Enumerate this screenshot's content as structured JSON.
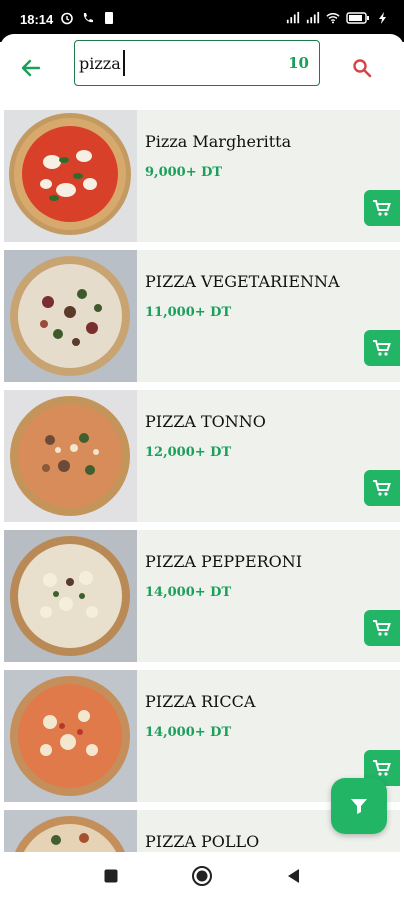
{
  "status_bar": {
    "time": "18:14",
    "icons": [
      "alarm-icon",
      "phone-icon",
      "sim-icon",
      "signal-icon",
      "signal-icon",
      "wifi-icon",
      "battery-icon",
      "charging-icon"
    ]
  },
  "header": {
    "back_icon": "arrow-left-icon",
    "search_value": "pizza",
    "result_count": "10",
    "search_icon": "search-icon"
  },
  "colors": {
    "accent": "#22b566",
    "price_green": "#1aa05a",
    "card_bg": "#eef1ec",
    "search_icon": "#d64545"
  },
  "products": [
    {
      "name": "Pizza Margheritta",
      "price": "9,000+ DT"
    },
    {
      "name": "PIZZA VEGETARIENNA",
      "price": "11,000+ DT"
    },
    {
      "name": "PIZZA TONNO",
      "price": "12,000+ DT"
    },
    {
      "name": "PIZZA PEPPERONI",
      "price": "14,000+ DT"
    },
    {
      "name": "PIZZA RICCA",
      "price": "14,000+ DT"
    },
    {
      "name": "PIZZA POLLO",
      "price": ""
    }
  ],
  "cart_icon": "cart-icon",
  "fab_icon": "filter-icon",
  "nav": {
    "buttons": [
      "recents-icon",
      "home-icon",
      "back-icon"
    ]
  }
}
